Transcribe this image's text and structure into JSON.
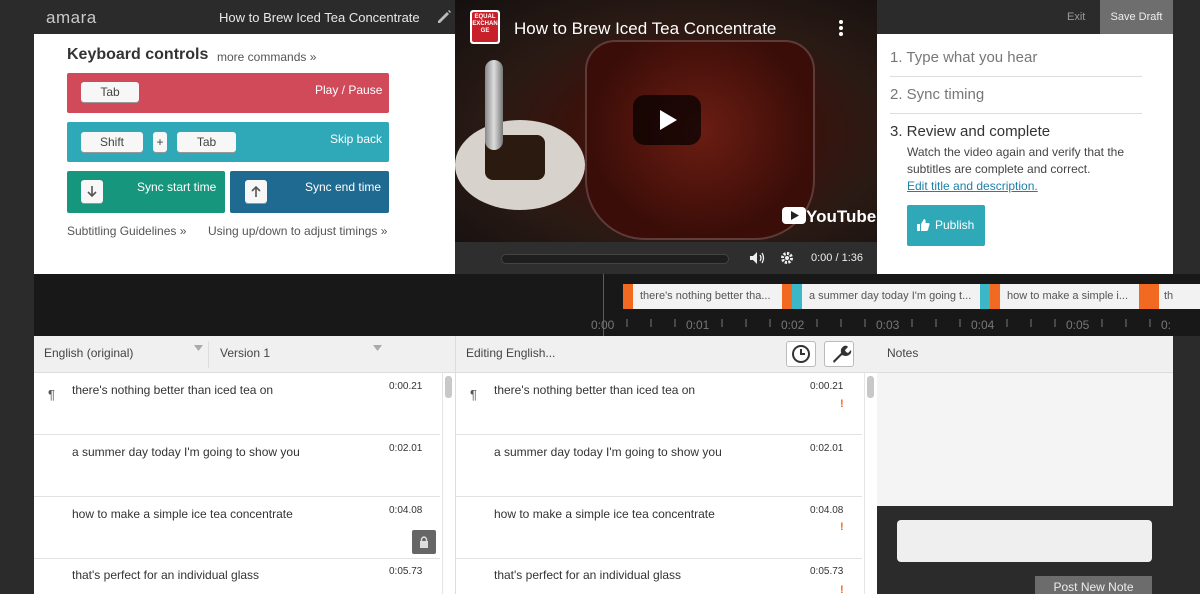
{
  "app": {
    "logo": "amara",
    "video_title": "How to Brew Iced Tea Concentrate",
    "exit": "Exit",
    "save_draft": "Save Draft"
  },
  "keyboard": {
    "title": "Keyboard controls",
    "more": "more commands »",
    "play_key": "Tab",
    "play_label": "Play / Pause",
    "skip_key1": "Shift",
    "skip_plus": "+",
    "skip_key2": "Tab",
    "skip_label": "Skip back",
    "sync_start": "Sync start time",
    "sync_end": "Sync end time",
    "guidelines": "Subtitling Guidelines »",
    "updown": "Using up/down to adjust timings »",
    "colors": {
      "play": "#d04a59",
      "skip": "#2fa8b8",
      "sync_start": "#16967c",
      "sync_end": "#1f6a91"
    }
  },
  "video": {
    "channel_logo": "EQUAL EXCHANGE",
    "title": "How to Brew Iced Tea Concentrate",
    "youtube": "YouTube",
    "time": "0:00 / 1:36"
  },
  "steps": {
    "s1": "1. Type what you hear",
    "s2": "2. Sync timing",
    "s3": "3. Review and complete",
    "desc": "Watch the video again and verify that the subtitles are complete and correct.",
    "link": "Edit title and description.",
    "publish": "Publish"
  },
  "timeline": {
    "segments": [
      "there's nothing better tha...",
      "a summer day today I'm going t...",
      "how to make a simple i...",
      "th"
    ],
    "ticks": [
      "0:00",
      "0:01",
      "0:02",
      "0:03",
      "0:04",
      "0:05",
      "0:"
    ]
  },
  "left": {
    "language": "English (original)",
    "version": "Version 1"
  },
  "middle": {
    "header": "Editing English..."
  },
  "notes": {
    "header": "Notes",
    "post": "Post New Note"
  },
  "subtitles": [
    {
      "text": "there's nothing better than iced tea on",
      "time": "0:00.21"
    },
    {
      "text": "a summer day today I'm going to show you",
      "time": "0:02.01"
    },
    {
      "text": "how to make a simple ice tea concentrate",
      "time": "0:04.08"
    },
    {
      "text": "that's perfect for an individual glass",
      "time": "0:05.73"
    }
  ],
  "icons": {
    "pilcrow": "¶",
    "warning": "!"
  }
}
